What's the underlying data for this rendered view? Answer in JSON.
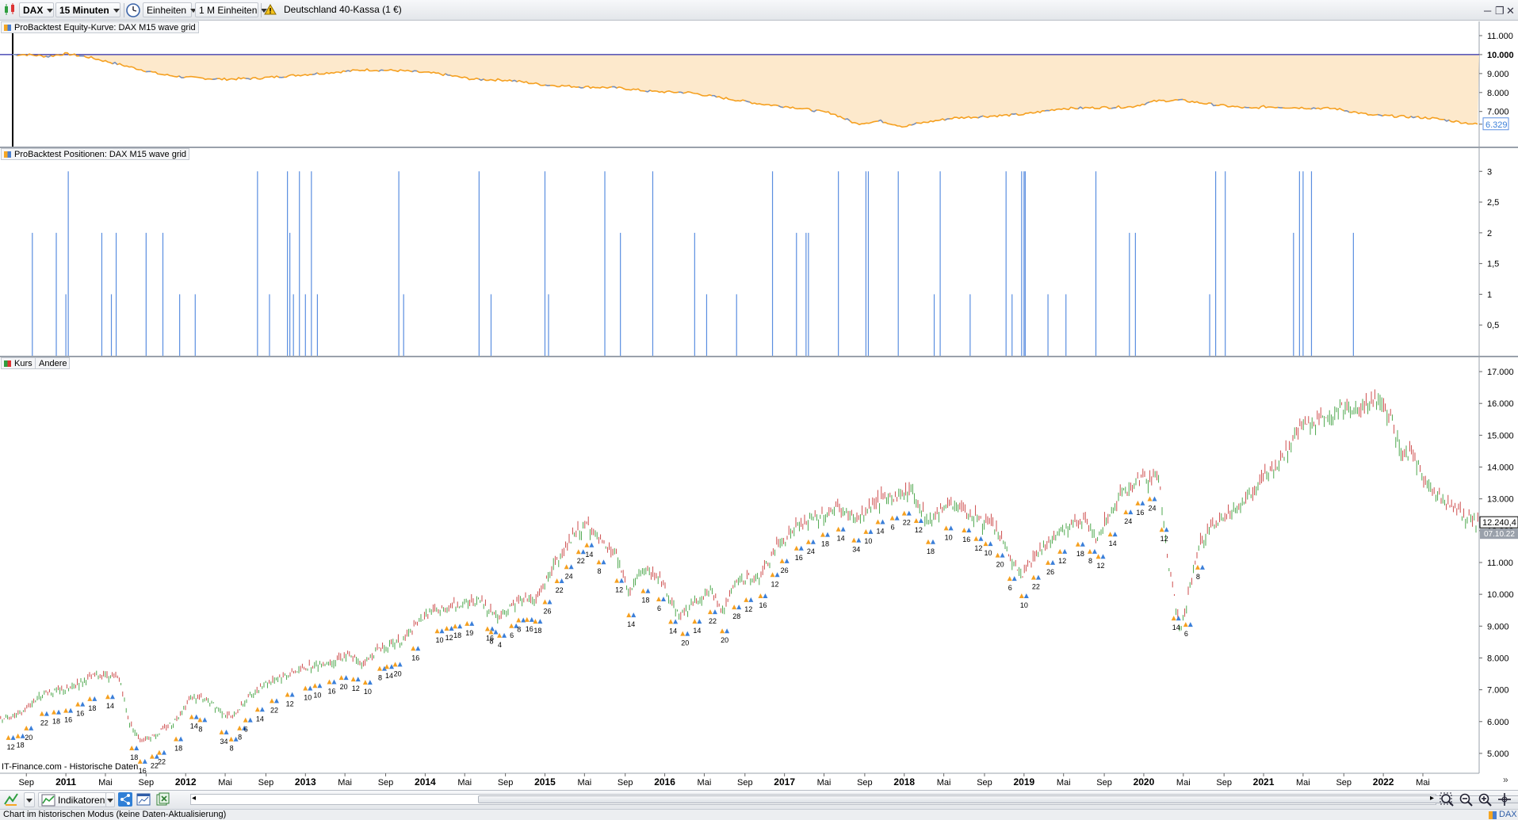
{
  "toolbar": {
    "instrument": "DAX",
    "timeframe": "15 Minuten",
    "units": "Einheiten",
    "units_amount": "1 M Einheiten",
    "market_name": "Deutschland 40-Kassa (1 €)"
  },
  "equity_panel": {
    "title": "ProBacktest Equity-Kurve: DAX M15 wave grid",
    "current_value": "6.329"
  },
  "positions_panel": {
    "title": "ProBacktest Positionen: DAX M15 wave grid"
  },
  "price_panel": {
    "tab_kurs": "Kurs",
    "tab_andere": "Andere",
    "last_price": "12.240,4",
    "last_date": "07.10.22",
    "source_label": "IT-Finance.com - Historische Daten"
  },
  "bottom": {
    "indicators_label": "Indikatoren",
    "status_text": "Chart im historischen Modus (keine Daten-Aktualisierung)",
    "instrument_tag": "DAX"
  },
  "colors": {
    "equity_line": "#f5a020",
    "equity_fill": "#fde9cc",
    "reference_line": "#2a2aa8",
    "positions_bar": "#5a8ee0",
    "candle_up": "#3a9e3a",
    "candle_down": "#c83a3a",
    "marker_orange": "#f5a020",
    "marker_blue": "#3b7fd9"
  },
  "chart_data": [
    {
      "type": "line",
      "name": "equity",
      "title": "ProBacktest Equity-Kurve: DAX M15 wave grid",
      "y_tick_labels": [
        "11.000",
        "10.000",
        "9.000",
        "8.000",
        "7.000",
        "6.329"
      ],
      "reference_value": 10000,
      "ylim": [
        5400,
        11500
      ],
      "x": [
        2010.67,
        2010.85,
        2011.0,
        2011.2,
        2011.4,
        2011.6,
        2011.8,
        2012.0,
        2012.3,
        2012.6,
        2012.9,
        2013.2,
        2013.5,
        2013.8,
        2014.1,
        2014.4,
        2014.7,
        2015.0,
        2015.3,
        2015.6,
        2015.9,
        2016.2,
        2016.5,
        2016.8,
        2017.1,
        2017.4,
        2017.6,
        2017.8,
        2018.0,
        2018.1,
        2018.4,
        2018.7,
        2019.0,
        2019.3,
        2019.6,
        2019.9,
        2020.1,
        2020.3,
        2020.6,
        2020.9,
        2021.0,
        2021.3,
        2021.6,
        2021.9,
        2022.1,
        2022.4,
        2022.77
      ],
      "y": [
        10000,
        9900,
        10050,
        9850,
        9550,
        9250,
        8950,
        8800,
        8700,
        8750,
        8900,
        9050,
        9200,
        9150,
        9000,
        8700,
        8650,
        8400,
        8300,
        8250,
        8050,
        8000,
        7700,
        7400,
        7200,
        6900,
        6350,
        6500,
        6200,
        6350,
        6650,
        6750,
        6850,
        7150,
        7200,
        7250,
        7550,
        7600,
        7350,
        7150,
        7250,
        7200,
        7150,
        6800,
        6750,
        6650,
        6329
      ]
    },
    {
      "type": "bar",
      "name": "positions",
      "title": "ProBacktest Positionen: DAX M15 wave grid",
      "y_tick_labels": [
        "3",
        "2,5",
        "2",
        "1,5",
        "1",
        "0,5"
      ],
      "ylim": [
        0,
        3.3
      ],
      "x": [
        2010.72,
        2010.92,
        2011.0,
        2011.02,
        2011.3,
        2011.38,
        2011.42,
        2011.67,
        2011.81,
        2011.95,
        2012.08,
        2012.6,
        2012.7,
        2012.85,
        2012.87,
        2012.9,
        2012.95,
        2013.0,
        2013.05,
        2013.1,
        2013.78,
        2013.82,
        2014.45,
        2014.55,
        2015.0,
        2015.03,
        2015.5,
        2015.63,
        2015.9,
        2016.25,
        2016.35,
        2016.6,
        2016.9,
        2017.1,
        2017.18,
        2017.2,
        2017.45,
        2017.68,
        2017.7,
        2017.95,
        2018.25,
        2018.3,
        2018.55,
        2018.85,
        2018.9,
        2018.98,
        2019.0,
        2019.01,
        2019.2,
        2019.35,
        2019.6,
        2019.88,
        2019.93,
        2020.55,
        2020.6,
        2020.68,
        2021.25,
        2021.3,
        2021.33,
        2021.4,
        2021.75
      ],
      "values": [
        2,
        2,
        1,
        3,
        2,
        1,
        2,
        2,
        2,
        1,
        1,
        3,
        1,
        3,
        2,
        1,
        3,
        1,
        3,
        1,
        3,
        1,
        3,
        1,
        3,
        1,
        3,
        2,
        3,
        2,
        1,
        1,
        3,
        2,
        2,
        2,
        3,
        3,
        3,
        3,
        1,
        3,
        1,
        3,
        1,
        3,
        3,
        3,
        1,
        1,
        3,
        2,
        2,
        1,
        3,
        3,
        2,
        3,
        3,
        3,
        2
      ]
    },
    {
      "type": "candlestick",
      "name": "price",
      "y_tick_labels": [
        "17.000",
        "16.000",
        "15.000",
        "14.000",
        "13.000",
        "12.000",
        "11.000",
        "10.000",
        "9.000",
        "8.000",
        "7.000",
        "6.000",
        "5.000"
      ],
      "ylim": [
        4500,
        17200
      ],
      "x_tick_labels": [
        "Sep",
        "2011",
        "Mai",
        "Sep",
        "2012",
        "Mai",
        "Sep",
        "2013",
        "Mai",
        "Sep",
        "2014",
        "Mai",
        "Sep",
        "2015",
        "Mai",
        "Sep",
        "2016",
        "Mai",
        "Sep",
        "2017",
        "Mai",
        "Sep",
        "2018",
        "Mai",
        "Sep",
        "2019",
        "Mai",
        "Sep",
        "2020",
        "Mai",
        "Sep",
        "2021",
        "Mai",
        "Sep",
        "2022",
        "Mai"
      ],
      "x_tick_positions": [
        2010.67,
        2011.0,
        2011.33,
        2011.67,
        2012.0,
        2012.33,
        2012.67,
        2013.0,
        2013.33,
        2013.67,
        2014.0,
        2014.33,
        2014.67,
        2015.0,
        2015.33,
        2015.67,
        2016.0,
        2016.33,
        2016.67,
        2017.0,
        2017.33,
        2017.67,
        2018.0,
        2018.33,
        2018.67,
        2019.0,
        2019.33,
        2019.67,
        2020.0,
        2020.33,
        2020.67,
        2021.0,
        2021.33,
        2021.67,
        2022.0,
        2022.33
      ],
      "xlim": [
        2010.45,
        2022.8
      ],
      "x": [
        2010.45,
        2010.6,
        2010.8,
        2011.0,
        2011.15,
        2011.3,
        2011.45,
        2011.52,
        2011.62,
        2011.75,
        2011.9,
        2012.05,
        2012.2,
        2012.38,
        2012.5,
        2012.65,
        2012.85,
        2013.0,
        2013.2,
        2013.35,
        2013.48,
        2013.6,
        2013.8,
        2014.0,
        2014.1,
        2014.3,
        2014.45,
        2014.6,
        2014.8,
        2014.92,
        2015.05,
        2015.25,
        2015.35,
        2015.5,
        2015.58,
        2015.7,
        2015.8,
        2015.95,
        2016.12,
        2016.25,
        2016.38,
        2016.48,
        2016.6,
        2016.8,
        2016.95,
        2017.1,
        2017.3,
        2017.45,
        2017.6,
        2017.75,
        2017.95,
        2018.05,
        2018.2,
        2018.3,
        2018.45,
        2018.6,
        2018.75,
        2018.9,
        2018.98,
        2019.1,
        2019.3,
        2019.5,
        2019.6,
        2019.8,
        2019.98,
        2020.12,
        2020.2,
        2020.3,
        2020.45,
        2020.6,
        2020.8,
        2020.9,
        2021.0,
        2021.1,
        2021.3,
        2021.5,
        2021.62,
        2021.8,
        2021.98,
        2022.05,
        2022.15,
        2022.22,
        2022.35,
        2022.5,
        2022.6,
        2022.77
      ],
      "y": [
        6100,
        6200,
        6900,
        7000,
        7300,
        7500,
        7300,
        6000,
        5400,
        5600,
        6000,
        6800,
        6600,
        6100,
        6700,
        7200,
        7500,
        7700,
        7900,
        8100,
        7800,
        8300,
        8500,
        9400,
        9500,
        9700,
        9800,
        9300,
        9900,
        9800,
        10800,
        11900,
        12200,
        11400,
        11300,
        10000,
        10800,
        10500,
        9300,
        9800,
        10100,
        9500,
        10400,
        10600,
        11600,
        12100,
        12500,
        12700,
        12300,
        12900,
        13100,
        13300,
        12300,
        12700,
        12800,
        12400,
        12100,
        11000,
        10600,
        11300,
        12000,
        12300,
        11700,
        13100,
        13600,
        13700,
        11000,
        8800,
        11500,
        12300,
        12800,
        13200,
        13700,
        14000,
        15200,
        15600,
        15800,
        15800,
        16200,
        15600,
        14400,
        14500,
        13500,
        13000,
        12600,
        12240
      ]
    }
  ]
}
